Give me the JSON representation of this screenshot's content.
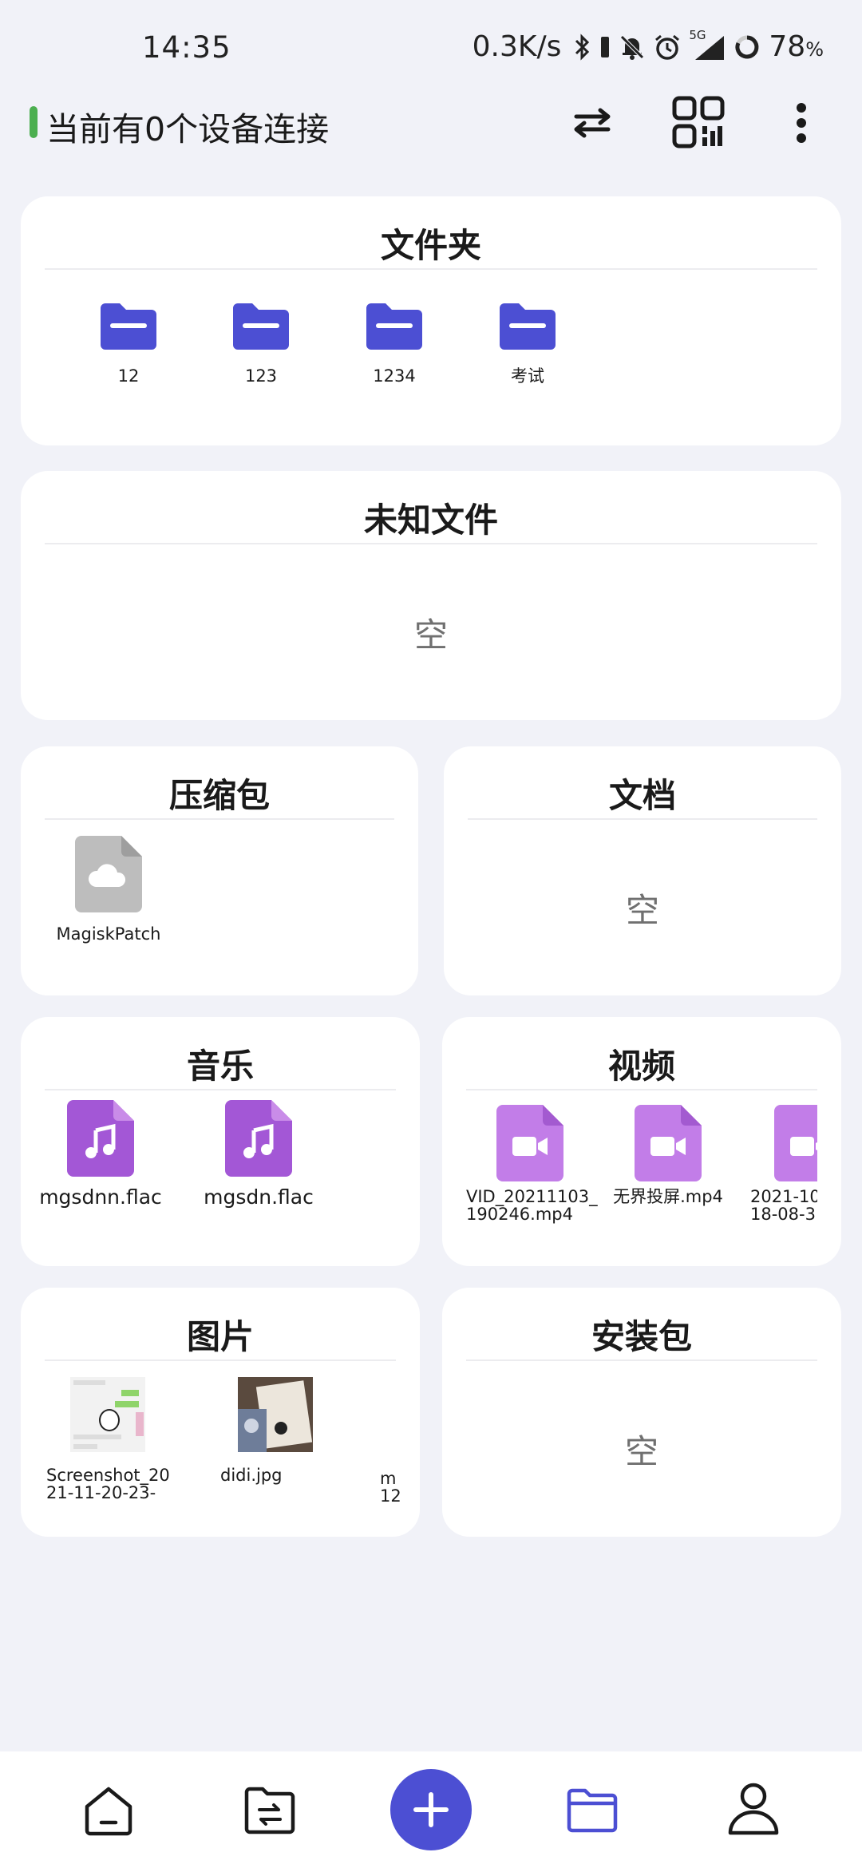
{
  "status_bar": {
    "time": "14:35",
    "net_speed": "0.3K/s",
    "network_type": "5G",
    "battery": "78",
    "battery_unit": "%"
  },
  "header": {
    "connection_text": "当前有0个设备连接",
    "indicator_color": "#4caf50",
    "icons": [
      "transfer-icon",
      "qr-code-icon",
      "more-vert-icon"
    ]
  },
  "folders": {
    "title": "文件夹",
    "items": [
      {
        "name": "12"
      },
      {
        "name": "123"
      },
      {
        "name": "1234"
      },
      {
        "name": "考试"
      }
    ]
  },
  "unknown": {
    "title": "未知文件",
    "empty_text": "空"
  },
  "archives": {
    "title": "压缩包",
    "items": [
      {
        "name": "MagiskPatch",
        "icon": "cloud-file-icon"
      }
    ]
  },
  "documents": {
    "title": "文档",
    "empty_text": "空"
  },
  "music": {
    "title": "音乐",
    "items": [
      {
        "name": "mgsdnn.flac",
        "icon": "music-file-icon"
      },
      {
        "name": "mgsdn.flac",
        "icon": "music-file-icon"
      }
    ]
  },
  "videos": {
    "title": "视频",
    "items": [
      {
        "line1": "VID_20211103_",
        "line2": "190246.mp4",
        "icon": "video-file-icon"
      },
      {
        "line1": "无界投屏.mp4",
        "line2": "",
        "icon": "video-file-icon"
      },
      {
        "line1": "2021-10-",
        "line2": "18-08-3",
        "icon": "video-file-icon"
      }
    ]
  },
  "images": {
    "title": "图片",
    "items": [
      {
        "line1": "Screenshot_20",
        "line2": "21-11-20-23-"
      },
      {
        "line1": "didi.jpg",
        "line2": ""
      },
      {
        "line1": "m",
        "line2": "12"
      }
    ]
  },
  "apks": {
    "title": "安装包",
    "empty_text": "空"
  },
  "bottom_nav": {
    "items": [
      "home-icon",
      "file-transfer-icon",
      "add-icon",
      "folder-icon",
      "profile-icon"
    ],
    "active": "folder-icon",
    "accent": "#4c4fd3"
  }
}
